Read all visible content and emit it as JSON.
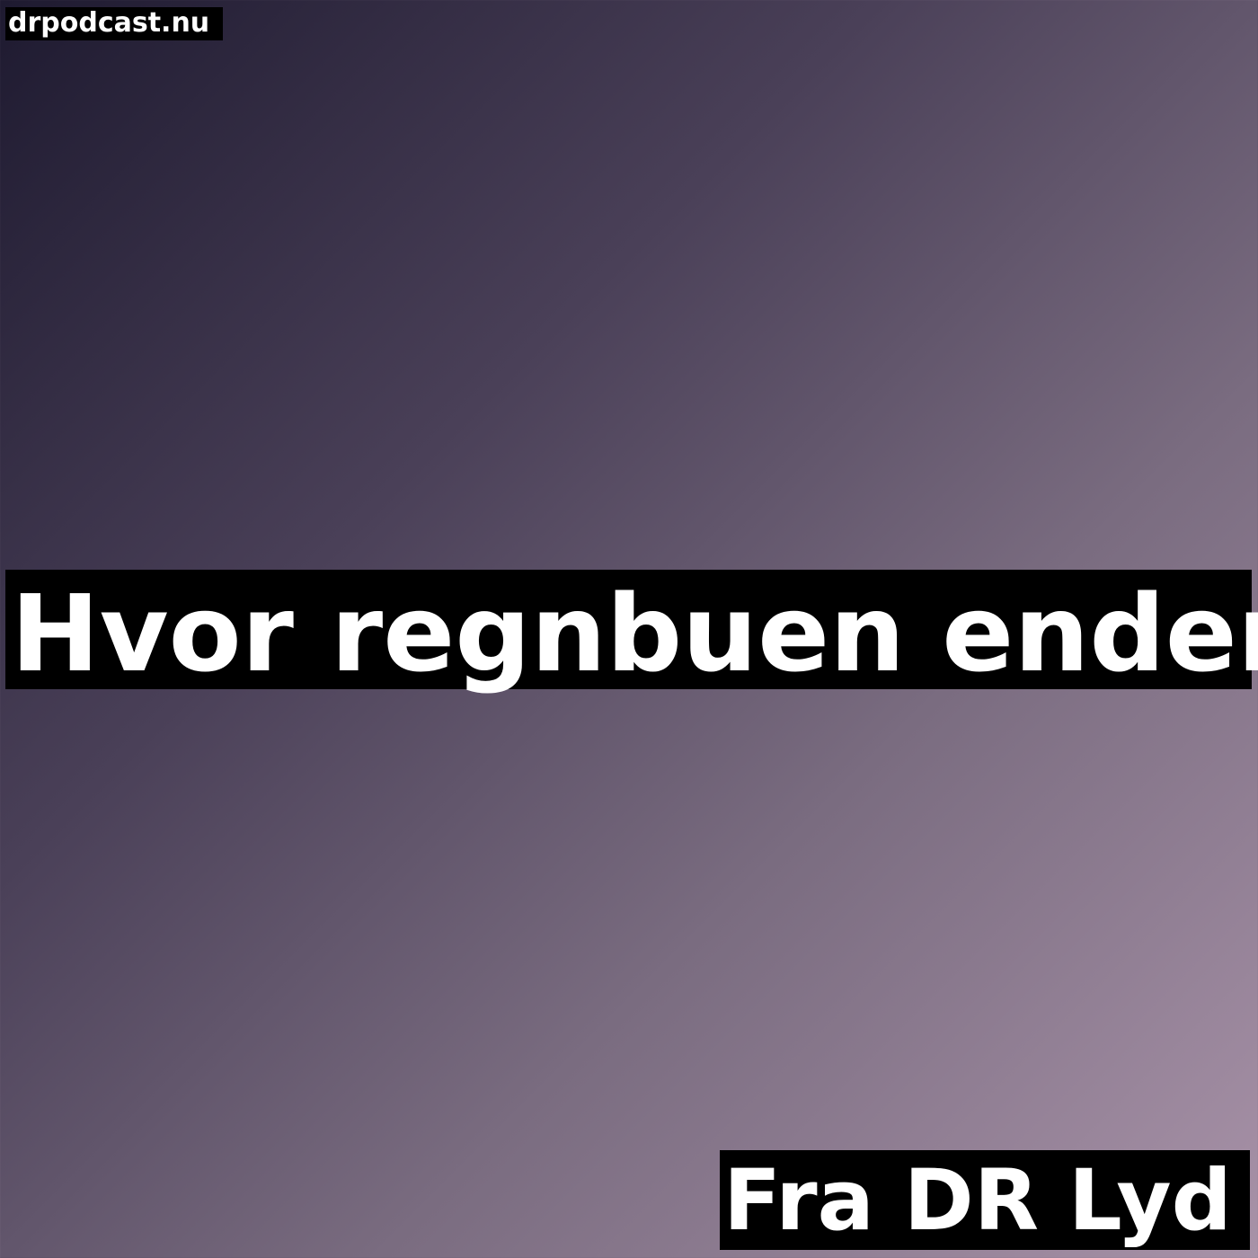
{
  "site_name": "drpodcast.nu",
  "title": "Hvor regnbuen ender",
  "footer": "Fra DR Lyd",
  "colors": {
    "gradient_start": "#1e1a30",
    "gradient_end": "#a892a8",
    "label_background": "#000000",
    "label_text": "#ffffff"
  }
}
